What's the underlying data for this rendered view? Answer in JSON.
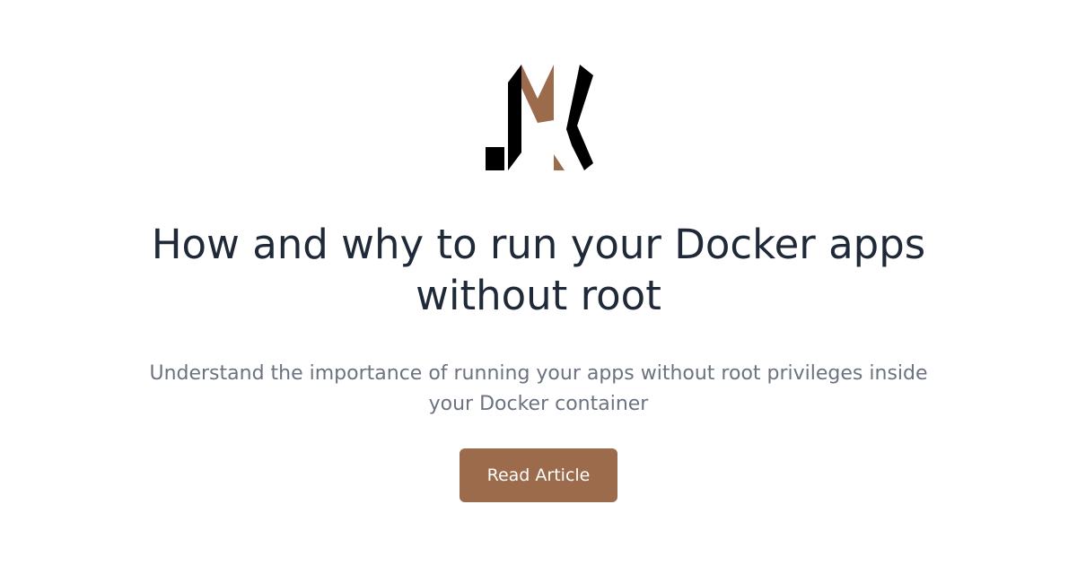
{
  "logo": {
    "name": "JM monogram logo",
    "colors": {
      "primary": "#000000",
      "accent": "#9b6b4b"
    }
  },
  "article": {
    "title": "How and why to run your Docker apps without root",
    "subtitle": "Understand the importance of running your apps without root privileges inside your Docker container"
  },
  "cta": {
    "label": "Read Article",
    "color": "#9b6b4b"
  }
}
